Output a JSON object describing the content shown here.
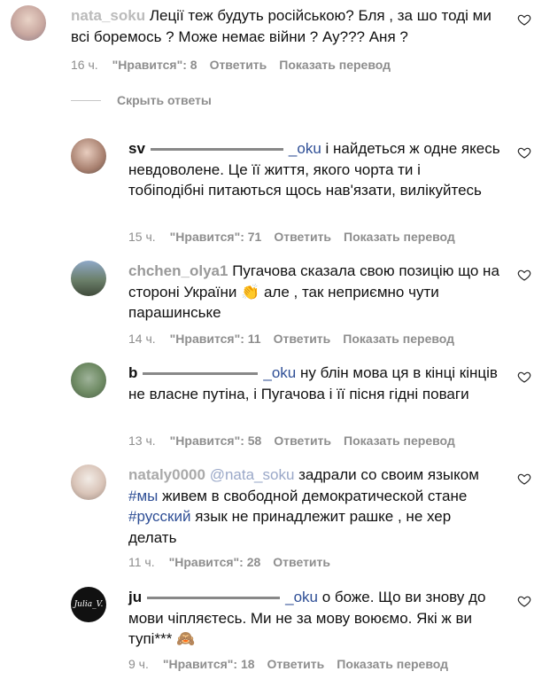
{
  "comments": [
    {
      "user_prefix": "",
      "user": "nata_soku",
      "mention": "",
      "text": "Леції теж будуть російською? Бля , за шо тоді ми всі боремось ? Може немає війни ? Ау??? Аня ?",
      "time": "16 ч.",
      "likes": "\"Нравится\": 8",
      "reply": "Ответить",
      "translate": "Показать перевод"
    },
    {
      "user": "sv",
      "mention": "_oku",
      "text": "і найдеться ж одне якесь невдоволене. Це її життя, якого чорта ти і тобіподібні питаються щось нав'язати, вилікуйтесь",
      "time": "15 ч.",
      "likes": "\"Нравится\": 71",
      "reply": "Ответить",
      "translate": "Показать перевод"
    },
    {
      "user": "chchen_olya1",
      "text": "Пугачова сказала свою позицію що на стороні України 👏 але , так неприємно чути парашинське",
      "time": "14 ч.",
      "likes": "\"Нравится\": 11",
      "reply": "Ответить",
      "translate": "Показать перевод"
    },
    {
      "user": "b",
      "mention": "_oku",
      "text": "ну блін мова ця в кінці кінців не власне путіна, і Пугачова і її пісня гідні поваги",
      "time": "13 ч.",
      "likes": "\"Нравится\": 58",
      "reply": "Ответить",
      "translate": "Показать перевод"
    },
    {
      "user": "nataly0000",
      "mention": "@nata_soku",
      "text_a": "задрали со своим языком",
      "tag1": "#мы",
      "text_b": "живем в свободной демократической стане",
      "tag2": "#русский",
      "text_c": "язык не принадлежит рашке , не хер делать",
      "time": "11 ч.",
      "likes": "\"Нравится\": 28",
      "reply": "Ответить"
    },
    {
      "user": "ju",
      "mention": "_oku",
      "avatar_text": "Julia_V.",
      "text": "о боже. Що ви знову до мови чіпляєтесь. Ми не за мову воюємо. Які ж ви тупі*** 🙈",
      "time": "9 ч.",
      "likes": "\"Нравится\": 18",
      "reply": "Ответить",
      "translate": "Показать перевод"
    }
  ],
  "hide_replies": "Скрыть ответы"
}
